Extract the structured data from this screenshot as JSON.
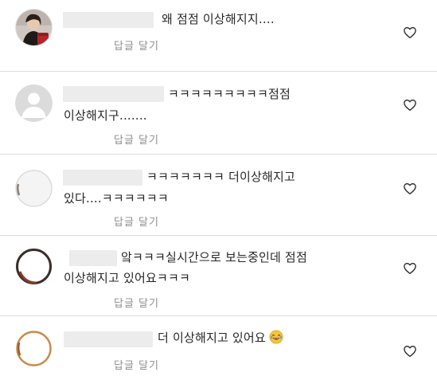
{
  "comments": [
    {
      "line1": "왜 점점 이상해지지....",
      "line2": "",
      "reply": "답글 달기",
      "avatar": "photo-avatar"
    },
    {
      "line1": "ㅋㅋㅋㅋㅋㅋㅋㅋㅋ점점",
      "line2": "이상해지구.......",
      "reply": "답글 달기",
      "avatar": "default-avatar"
    },
    {
      "line1": "ㅋㅋㅋㅋㅋㅋㅋ 더이상해지고",
      "line2": "있다....ㅋㅋㅋㅋㅋㅋ",
      "reply": "답글 달기",
      "avatar": "blurred-avatar"
    },
    {
      "line1": "앜ㅋㅋㅋ실시간으로 보는중인데 점점",
      "line2": "이상해지고 있어요ㅋㅋㅋ",
      "reply": "답글 달기",
      "avatar": "blurred-avatar"
    },
    {
      "line1": "더 이상해지고 있어요",
      "line2": "",
      "reply": "답글 달기",
      "avatar": "blurred-avatar",
      "emoji": "laughing-crying-emoji"
    }
  ],
  "colors": {
    "text": "#262626",
    "secondary": "#8e8e8e",
    "divider": "#dbdbdb",
    "name_blur": "#ececec"
  },
  "icons": [
    "heart-icon",
    "default-avatar-icon",
    "laughing-crying-emoji"
  ]
}
